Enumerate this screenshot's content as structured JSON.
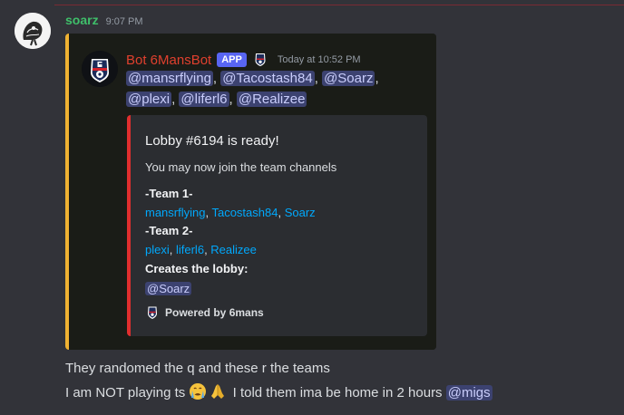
{
  "message": {
    "author": "soarz",
    "time": "9:07 PM",
    "line1": "They randomed the q and these r the teams",
    "line2_pre": "I am NOT playing ts ",
    "line2_post": " I told them ima be home in 2 hours ",
    "line2_mention": "@migs",
    "emojis": [
      "crying-face-icon",
      "folded-hands-icon"
    ]
  },
  "forward": {
    "bot_name": "Bot 6MansBot",
    "app_badge": "APP",
    "bot_time": "Today at 10:52 PM",
    "mentions": [
      "@mansrflying",
      "@Tacostash84",
      "@Soarz",
      "@plexi",
      "@liferl6",
      "@Realizee"
    ],
    "separator": ","
  },
  "embed": {
    "title": "Lobby #6194 is ready!",
    "description": "You may now join the team channels",
    "team1_label": "-Team 1-",
    "team1_players": [
      "mansrflying",
      "Tacostash84",
      "Soarz"
    ],
    "team2_label": "-Team 2-",
    "team2_players": [
      "plexi",
      "liferl6",
      "Realizee"
    ],
    "creator_label": "Creates the lobby:",
    "creator": "@Soarz",
    "footer": "Powered by 6mans"
  },
  "colors": {
    "author": "#3fbf6a",
    "bot_name": "#e0402e",
    "app_badge": "#5865f2",
    "forward_bar": "#f0b232",
    "embed_bar": "#e02e2e",
    "link": "#00a8fc",
    "mention_bg": "#3c4270"
  }
}
